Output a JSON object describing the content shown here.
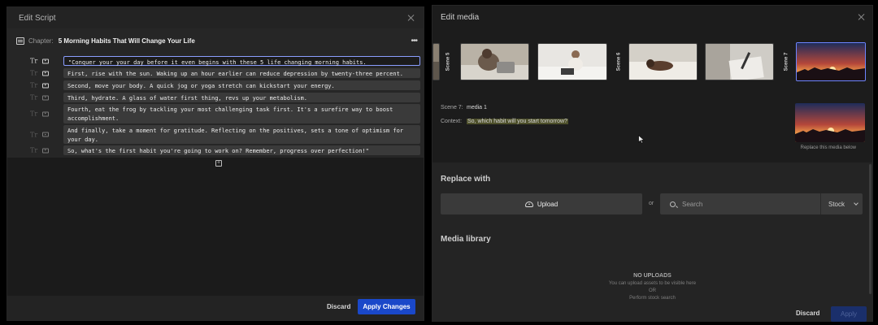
{
  "script_editor": {
    "title": "Edit Script",
    "chapter_label": "Chapter:",
    "chapter_title": "5 Morning Habits That Will Change Your Life",
    "more_glyph": "•••",
    "text_icon_glyph": "Tr",
    "add_glyph": "+",
    "lines": [
      "\"Conquer your your day before it even begins with these 5 life changing morning habits.",
      "First, rise with the sun. Waking up an hour earlier can reduce depression by twenty-three percent.",
      "Second, move your body. A quick jog or yoga stretch can kickstart your energy.",
      "Third, hydrate. A glass of water first thing, revs up your metabolism.",
      "Fourth, eat the frog by tackling your most challenging task first. It's a surefire way to boost accomplishment.",
      "And finally, take a moment for gratitude. Reflecting on the positives, sets a tone of optimism for your day.",
      "So, what's the first habit you're going to work on? Remember, progress over perfection!\""
    ],
    "discard_label": "Discard",
    "apply_label": "Apply Changes"
  },
  "media_editor": {
    "title": "Edit media",
    "scenes": [
      {
        "tag": "Scene 5"
      },
      {
        "tag": "Scene 6"
      },
      {
        "tag": "Scene 7"
      }
    ],
    "scene_label": "Scene 7:",
    "scene_value": "media 1",
    "context_label": "Context:",
    "context_value": "So, which habit will you start tomorrow?",
    "preview_caption": "Replace this media below",
    "replace_title": "Replace with",
    "upload_label": "Upload",
    "or_label": "or",
    "search_placeholder": "Search",
    "stock_label": "Stock",
    "library_title": "Media library",
    "empty_title": "NO UPLOADS",
    "empty_line1": "You can upload assets to be visible here",
    "empty_line2": "OR",
    "empty_line3": "Perform stock search",
    "discard_label": "Discard",
    "apply_label": "Apply"
  },
  "colors": {
    "accent_blue": "#1a48c9",
    "selected_border": "#6d84ff",
    "context_highlight": "#4d4f2a"
  }
}
